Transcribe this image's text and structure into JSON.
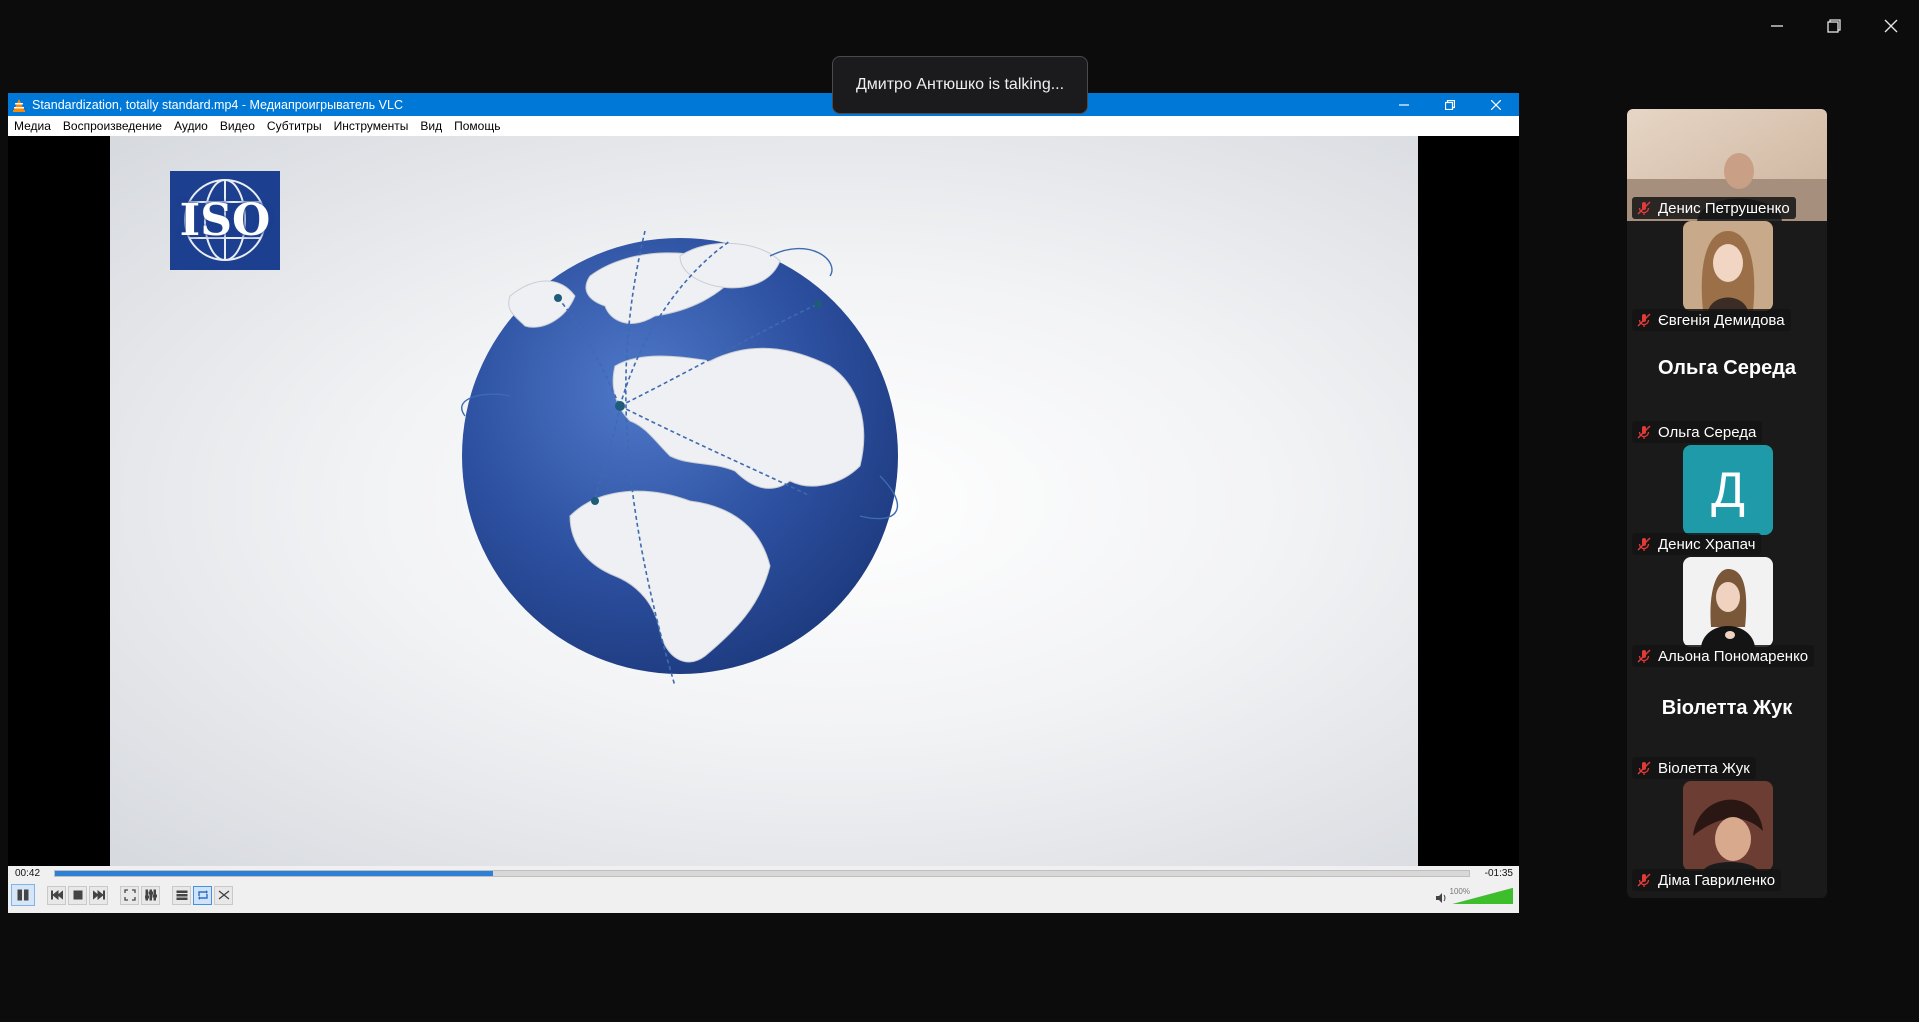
{
  "window_controls": {
    "minimize": "minimize",
    "restore": "restore",
    "close": "close"
  },
  "toast": {
    "text": "Дмитро Антюшко is talking..."
  },
  "vlc": {
    "title": "Standardization, totally standard.mp4 - Медиапроигрыватель VLC",
    "menu": [
      "Медиа",
      "Воспроизведение",
      "Аудио",
      "Видео",
      "Субтитры",
      "Инструменты",
      "Вид",
      "Помощь"
    ],
    "video": {
      "logo_text": "ISO"
    },
    "time_current": "00:42",
    "time_remaining": "-01:35",
    "progress": 0.31,
    "volume_label": "100%",
    "volume": 1.0,
    "loop_enabled": true,
    "colors": {
      "titlebar": "#0078d7",
      "seek_fill": "#2e7fd6"
    }
  },
  "participants": [
    {
      "name": "Денис Петрушенко",
      "type": "video",
      "muted": true
    },
    {
      "name": "Євгенія Демидова",
      "type": "photo",
      "muted": true
    },
    {
      "name": "Ольга Середа",
      "type": "name",
      "display": "Ольга Середа",
      "muted": true
    },
    {
      "name": "Денис Храпач",
      "type": "letter",
      "letter": "Д",
      "muted": true
    },
    {
      "name": "Альона Пономаренко",
      "type": "photo",
      "muted": true
    },
    {
      "name": "Віолетта Жук",
      "type": "name",
      "display": "Віолетта Жук",
      "muted": true
    },
    {
      "name": "Діма Гавриленко",
      "type": "photo",
      "muted": true
    }
  ]
}
